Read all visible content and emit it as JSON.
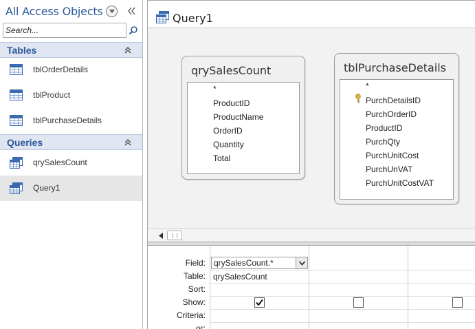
{
  "nav": {
    "title": "All Access Objects",
    "search_placeholder": "Search...",
    "groups": [
      {
        "label": "Tables",
        "items": [
          {
            "label": "tblOrderDetails",
            "icon": "table-icon"
          },
          {
            "label": "tblProduct",
            "icon": "table-icon"
          },
          {
            "label": "tblPurchaseDetails",
            "icon": "table-icon"
          }
        ]
      },
      {
        "label": "Queries",
        "items": [
          {
            "label": "qrySalesCount",
            "icon": "query-icon"
          },
          {
            "label": "Query1",
            "icon": "query-icon",
            "selected": true
          }
        ]
      }
    ]
  },
  "query": {
    "title": "Query1",
    "field_lists": [
      {
        "title": "qrySalesCount",
        "fields": [
          "*",
          "ProductID",
          "ProductName",
          "OrderID",
          "Quantity",
          "Total"
        ]
      },
      {
        "title": "tblPurchaseDetails",
        "fields": [
          "*",
          "PurchDetailsID",
          "PurchOrderID",
          "ProductID",
          "PurchQty",
          "PurchUnitCost",
          "PurchUnVAT",
          "PurchUnitCostVAT"
        ],
        "primary_key": "PurchDetailsID"
      }
    ],
    "grid": {
      "row_labels": {
        "field": "Field:",
        "table": "Table:",
        "sort": "Sort:",
        "show": "Show:",
        "criteria": "Criteria:",
        "or": "or:"
      },
      "columns": [
        {
          "field": "qrySalesCount.*",
          "table": "qrySalesCount",
          "show": true
        },
        {
          "field": "",
          "table": "",
          "show": false
        },
        {
          "field": "",
          "table": "",
          "show": false
        }
      ]
    }
  },
  "colors": {
    "accent": "#2b579a",
    "group_header_bg": "#dfe6f2",
    "selected_item_bg": "#e6e6e6",
    "design_bg": "#f2f2f2"
  }
}
